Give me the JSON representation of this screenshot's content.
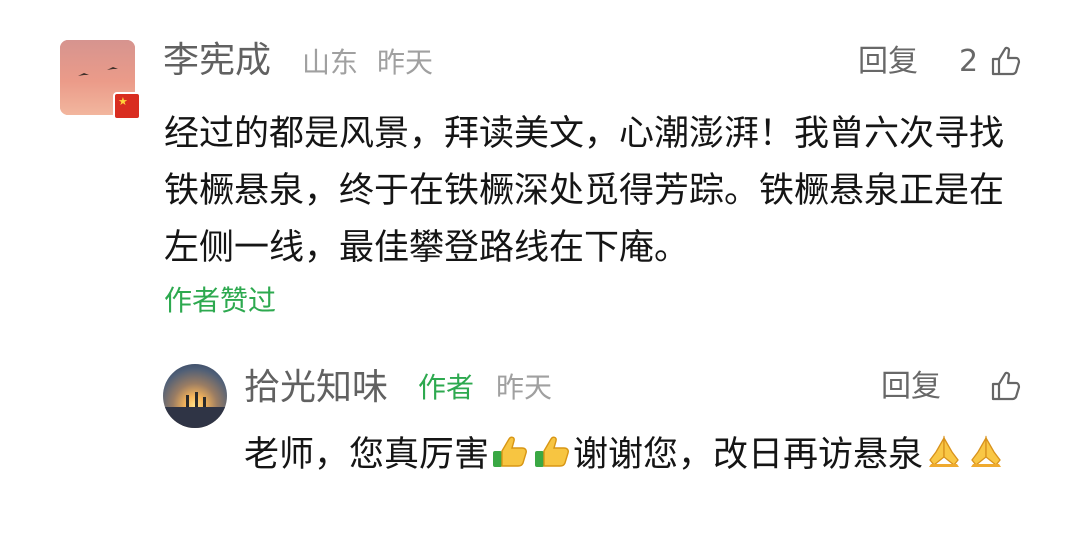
{
  "comment": {
    "username": "李宪成",
    "location": "山东",
    "time": "昨天",
    "reply_label": "回复",
    "like_count": "2",
    "text": "经过的都是风景，拜读美文，心潮澎湃！我曾六次寻找铁橛悬泉，终于在铁橛深处觅得芳踪。铁橛悬泉正是在左侧一线，最佳攀登路线在下庵。",
    "liked_by_author": "作者赞过"
  },
  "reply": {
    "username": "拾光知味",
    "author_tag": "作者",
    "time": "昨天",
    "reply_label": "回复",
    "text_part1": "老师，您真厉害",
    "text_part2": "谢谢您，改日再访悬泉"
  },
  "icons": {
    "like": "thumbs-up-outline-icon",
    "emoji_thumb": "thumbs-up-emoji",
    "emoji_pray": "pray-emoji",
    "flag": "china-flag-badge"
  },
  "colors": {
    "username": "#616161",
    "meta": "#a0a0a0",
    "author_green": "#2da94f",
    "body_text": "#151515"
  }
}
